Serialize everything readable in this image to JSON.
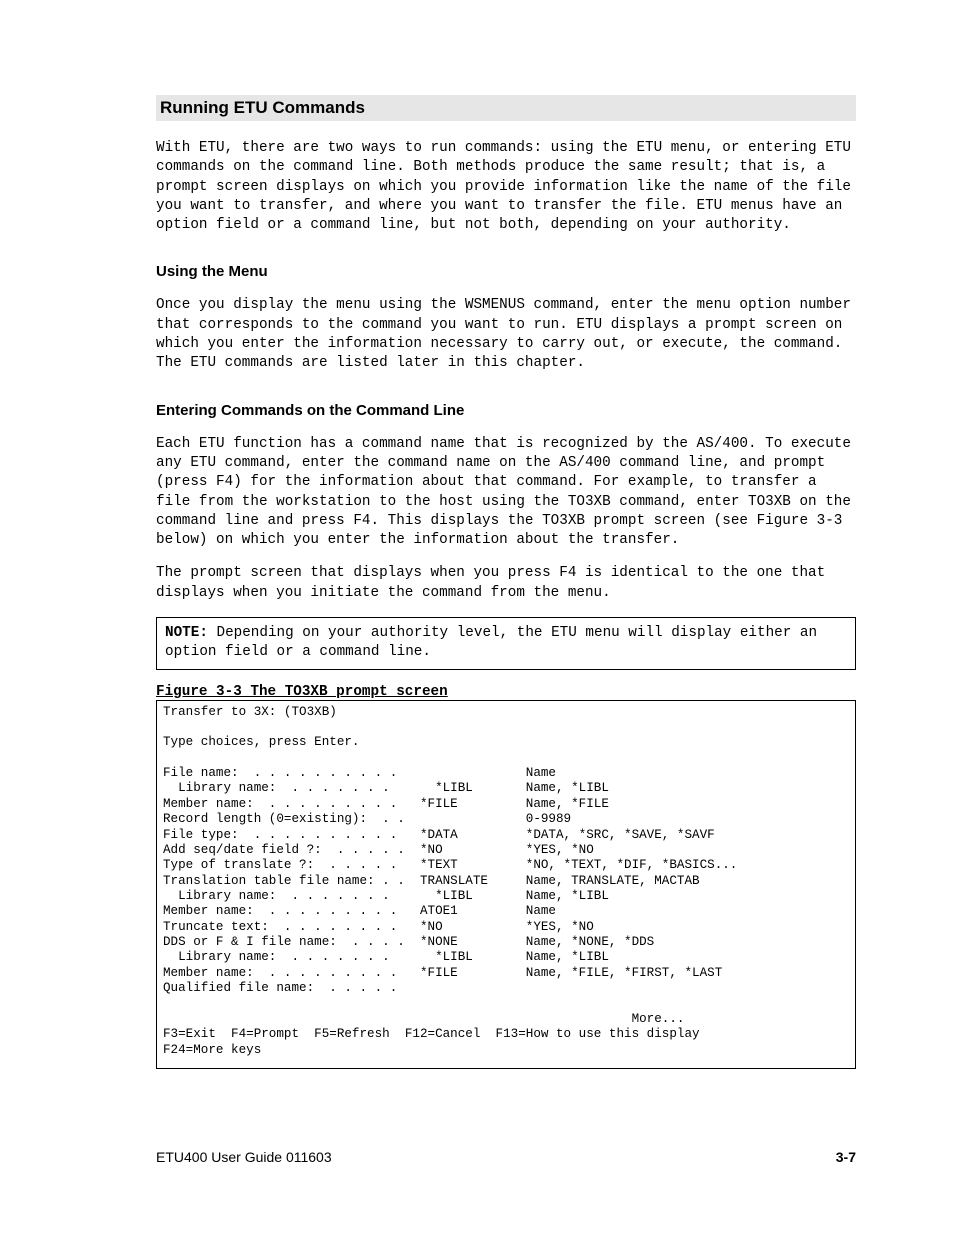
{
  "headings": {
    "h1": "Running ETU Commands",
    "h2a": "Using the Menu",
    "h2b": "Entering Commands on the Command Line",
    "fig": "Figure 3-3 The TO3XB prompt screen"
  },
  "paras": {
    "p1": "With ETU, there are two ways to run commands: using the ETU menu, or entering ETU commands on the command line. Both methods produce the same result; that is, a prompt screen displays on which you provide information like the name of the file you want to transfer, and where you want to transfer the file. ETU menus have an option field or a command line, but not both, depending on your authority.",
    "p2": "Once you display the menu using the WSMENUS command, enter the menu option number that corresponds to the command you want to run. ETU displays a prompt screen on which you enter the information necessary to carry out, or execute, the command. The ETU commands are listed later in this chapter.",
    "p3": "Each ETU function has a command name that is recognized by the AS/400. To execute any ETU command, enter the command name on the AS/400 command line, and prompt (press F4) for the information about that command. For example, to transfer a file from the workstation to the host using the TO3XB command, enter TO3XB on the command line and press F4. This displays the TO3XB prompt screen (see Figure 3-3 below) on which you enter the information about the transfer.",
    "p4": "The prompt screen that displays when you press F4 is identical to the one that displays when you initiate the command from the menu."
  },
  "note": {
    "label": "NOTE:",
    "text": " Depending on your authority level, the ETU menu will display either an option field or a command line."
  },
  "screen": {
    "title": "Transfer to 3X: (TO3XB)",
    "intro": "Type choices, press Enter.",
    "rows": [
      {
        "label": "File name:  . . . . . . . . . .",
        "value": "",
        "hint": "Name"
      },
      {
        "label": "  Library name:  . . . . . . .",
        "value": "  *LIBL",
        "hint": "Name, *LIBL"
      },
      {
        "label": "Member name:  . . . . . . . . .",
        "value": "*FILE",
        "hint": "Name, *FILE"
      },
      {
        "label": "Record length (0=existing):  . .",
        "value": "",
        "hint": "0-9989"
      },
      {
        "label": "File type:  . . . . . . . . . .",
        "value": "*DATA",
        "hint": "*DATA, *SRC, *SAVE, *SAVF"
      },
      {
        "label": "Add seq/date field ?:  . . . . .",
        "value": "*NO",
        "hint": "*YES, *NO"
      },
      {
        "label": "Type of translate ?:  . . . . .",
        "value": "*TEXT",
        "hint": "*NO, *TEXT, *DIF, *BASICS..."
      },
      {
        "label": "Translation table file name: . .",
        "value": "TRANSLATE",
        "hint": "Name, TRANSLATE, MACTAB"
      },
      {
        "label": "  Library name:  . . . . . . .",
        "value": "  *LIBL",
        "hint": "Name, *LIBL"
      },
      {
        "label": "Member name:  . . . . . . . . .",
        "value": "ATOE1",
        "hint": "Name"
      },
      {
        "label": "Truncate text:  . . . . . . . .",
        "value": "*NO",
        "hint": "*YES, *NO"
      },
      {
        "label": "DDS or F & I file name:  . . . .",
        "value": "*NONE",
        "hint": "Name, *NONE, *DDS"
      },
      {
        "label": "  Library name:  . . . . . . .",
        "value": "  *LIBL",
        "hint": "Name, *LIBL"
      },
      {
        "label": "Member name:  . . . . . . . . .",
        "value": "*FILE",
        "hint": "Name, *FILE, *FIRST, *LAST"
      },
      {
        "label": "Qualified file name:  . . . . .",
        "value": "",
        "hint": ""
      }
    ],
    "more": "More...",
    "fkeys1": "F3=Exit  F4=Prompt  F5=Refresh  F12=Cancel  F13=How to use this display",
    "fkeys2": "F24=More keys"
  },
  "footer": {
    "left": "ETU400 User Guide 011603",
    "right": "3-7"
  }
}
